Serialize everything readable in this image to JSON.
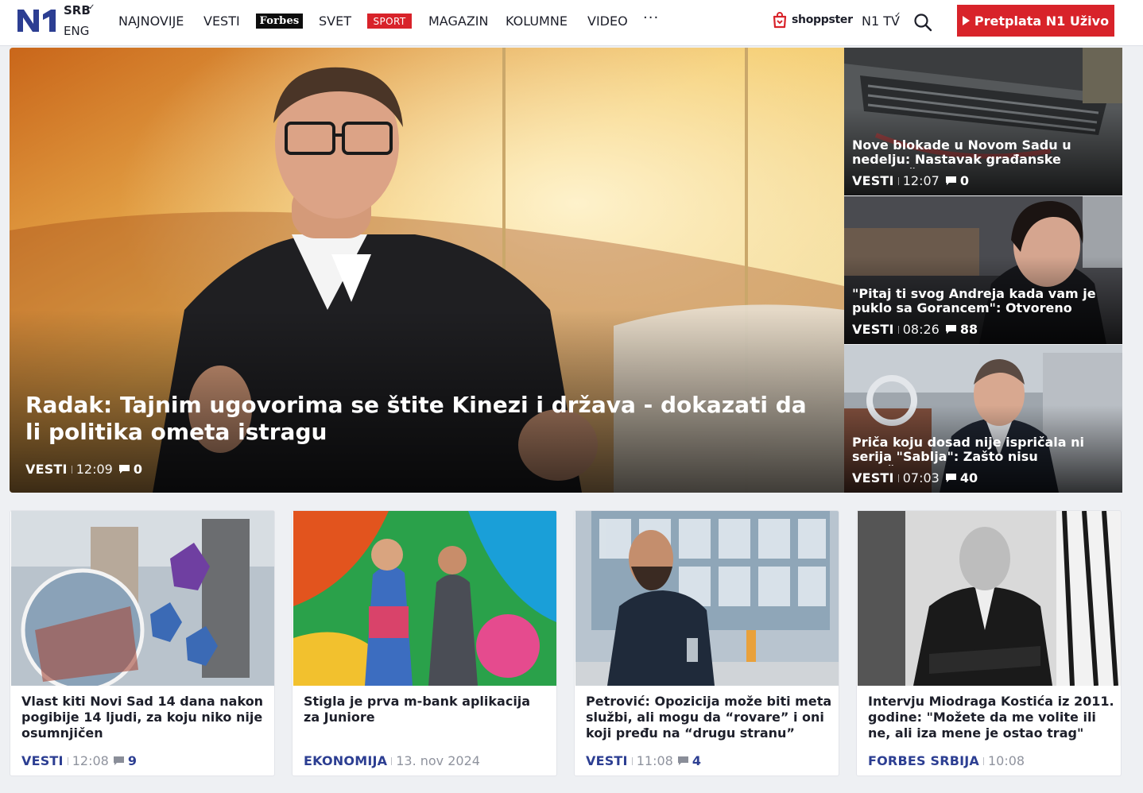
{
  "header": {
    "lang_primary": "SRB",
    "lang_secondary": "ENG",
    "nav": [
      "NAJNOVIJE",
      "VESTI",
      "Forbes",
      "SVET",
      "SPORT",
      "MAGAZIN",
      "KOLUMNE",
      "VIDEO"
    ],
    "more": "···",
    "shoppster": "shoppster",
    "n1tv": "N1 TV",
    "cta": "Pretplata N1 Uživo"
  },
  "hero": {
    "title": "Radak: Tajnim ugovorima se štite Kinezi i država - dokazati da li politika ometa istragu",
    "category": "VESTI",
    "time": "12:09",
    "comments": "0"
  },
  "side_stories": [
    {
      "title": "Nove blokade u Novom Sadu u nedelju: Nastavak građanske neposlušnosti,",
      "category": "VESTI",
      "time": "12:07",
      "comments": "0"
    },
    {
      "title": "\"Pitaj ti svog Andreja kada vam je puklo sa Gorancem\": Otvoreno pismo",
      "category": "VESTI",
      "time": "08:26",
      "comments": "88"
    },
    {
      "title": "Priča koju dosad nije ispričala ni serija \"Sablja\": Zašto nisu razjašnjene veze",
      "category": "VESTI",
      "time": "07:03",
      "comments": "40"
    }
  ],
  "cards": [
    {
      "title": "Vlast kiti Novi Sad 14 dana nakon pogibije 14 ljudi, za koju niko nije osumnjičen",
      "category": "VESTI",
      "time": "12:08",
      "comments": "9"
    },
    {
      "title": "Stigla je prva m-bank aplikacija za Juniore",
      "category": "EKONOMIJA",
      "time": "13. nov 2024",
      "comments": ""
    },
    {
      "title": "Petrović: Opozicija može biti meta službi, ali mogu da “rovare” i oni koji pređu na “drugu stranu”",
      "category": "VESTI",
      "time": "11:08",
      "comments": "4"
    },
    {
      "title": "Intervju Miodraga Kostića iz 2011. godine: \"Možete da me volite ili ne, ali iza mene je ostao trag\"",
      "category": "FORBES SRBIJA",
      "time": "10:08",
      "comments": ""
    }
  ],
  "colors": {
    "brand_blue": "#2c3e92",
    "accent_red": "#d8232a",
    "page_bg": "#eef0f3"
  },
  "icons": [
    "n1-logo",
    "chevron-down-icon",
    "ellipsis-icon",
    "shoppster-bag-icon",
    "search-icon",
    "play-icon",
    "comment-icon"
  ]
}
